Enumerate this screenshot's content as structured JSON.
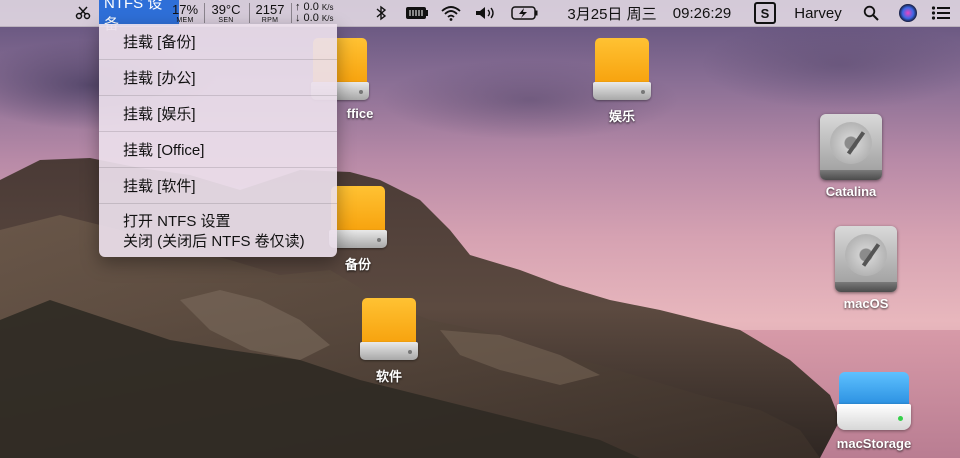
{
  "menubar": {
    "ntfs_label": "NTFS 设备",
    "mem_value": "17%",
    "mem_label": "MEM",
    "sen_value": "39°C",
    "sen_label": "SEN",
    "rpm_value": "2157",
    "rpm_label": "RPM",
    "net_up": "↑ 0.0",
    "net_down": "↓ 0.0",
    "net_unit": "K/s",
    "date": "3月25日 周三",
    "time": "09:26:29",
    "user": "Harvey",
    "icons": [
      "scissors-icon",
      "bluetooth-icon",
      "battery-status-icon",
      "wifi-icon",
      "volume-icon",
      "battery-icon",
      "app-s-icon",
      "search-icon",
      "siri-icon",
      "control-center-icon"
    ]
  },
  "dropdown": {
    "items": [
      "挂载 [备份]",
      "挂载 [办公]",
      "挂载 [娱乐]",
      "挂载 [Office]",
      "挂载 [软件]"
    ],
    "open_settings": "打开 NTFS 设置",
    "close_label": "关闭 (关闭后 NTFS 卷仅读)"
  },
  "desktop": {
    "icons": [
      {
        "label": "ffice",
        "type": "orange-drive"
      },
      {
        "label": "娱乐",
        "type": "orange-drive"
      },
      {
        "label": "备份",
        "type": "orange-drive"
      },
      {
        "label": "软件",
        "type": "orange-drive"
      },
      {
        "label": "Catalina",
        "type": "hdd"
      },
      {
        "label": "macOS",
        "type": "hdd"
      },
      {
        "label": "macStorage",
        "type": "external"
      }
    ]
  }
}
